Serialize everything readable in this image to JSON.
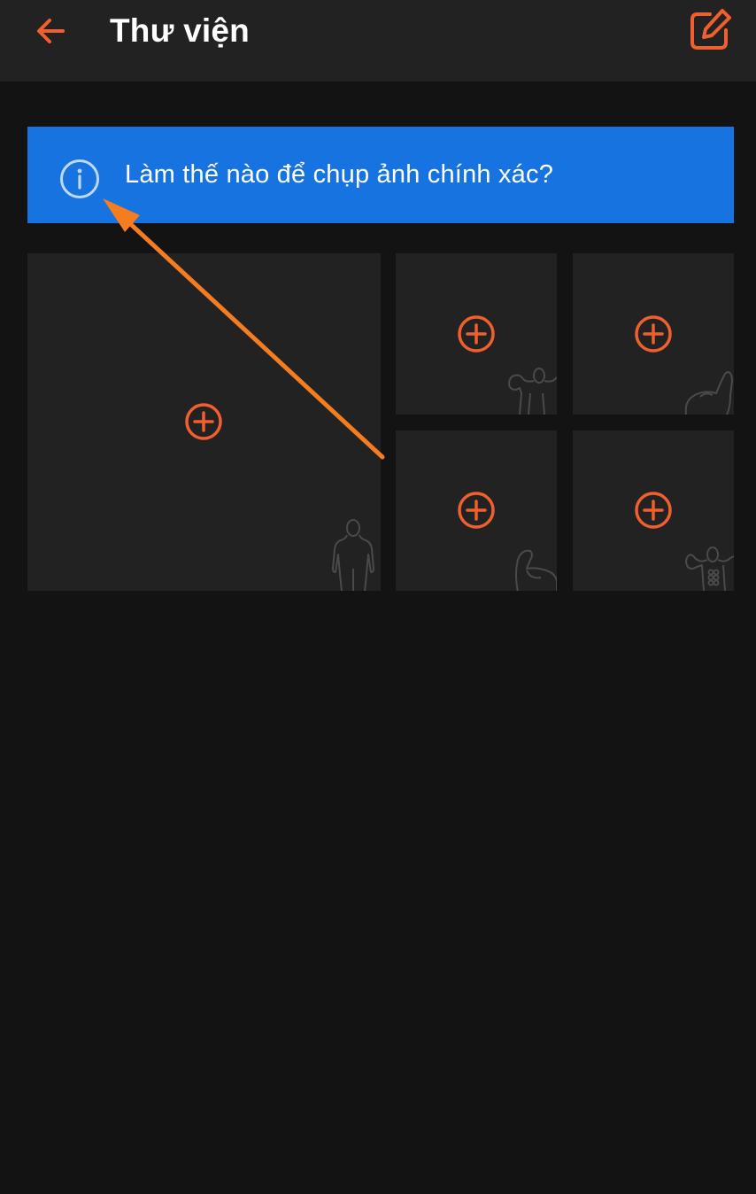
{
  "header": {
    "title": "Thư viện",
    "back_icon": "arrow-left-icon",
    "edit_icon": "edit-square-icon"
  },
  "banner": {
    "text": "Làm thế nào để chụp ảnh chính xác?",
    "icon": "info-circle-icon"
  },
  "photo_slots": [
    {
      "name": "front-body",
      "icon": "add-circle-icon",
      "silhouette": "front-body-silhouette-icon"
    },
    {
      "name": "back-double-bicep",
      "icon": "add-circle-icon",
      "silhouette": "back-pose-silhouette-icon"
    },
    {
      "name": "bicep-flex-right",
      "icon": "add-circle-icon",
      "silhouette": "bicep-flex-silhouette-icon"
    },
    {
      "name": "bicep-flex-left",
      "icon": "add-circle-icon",
      "silhouette": "bicep-flex-silhouette-icon"
    },
    {
      "name": "abs-pose",
      "icon": "add-circle-icon",
      "silhouette": "abs-pose-silhouette-icon"
    }
  ],
  "colors": {
    "accent": "#F0602E",
    "banner": "#1673E0",
    "header_bg": "#222222",
    "page_bg": "#131313",
    "slot_bg": "#222222",
    "annotation_arrow": "#F57C1F"
  }
}
